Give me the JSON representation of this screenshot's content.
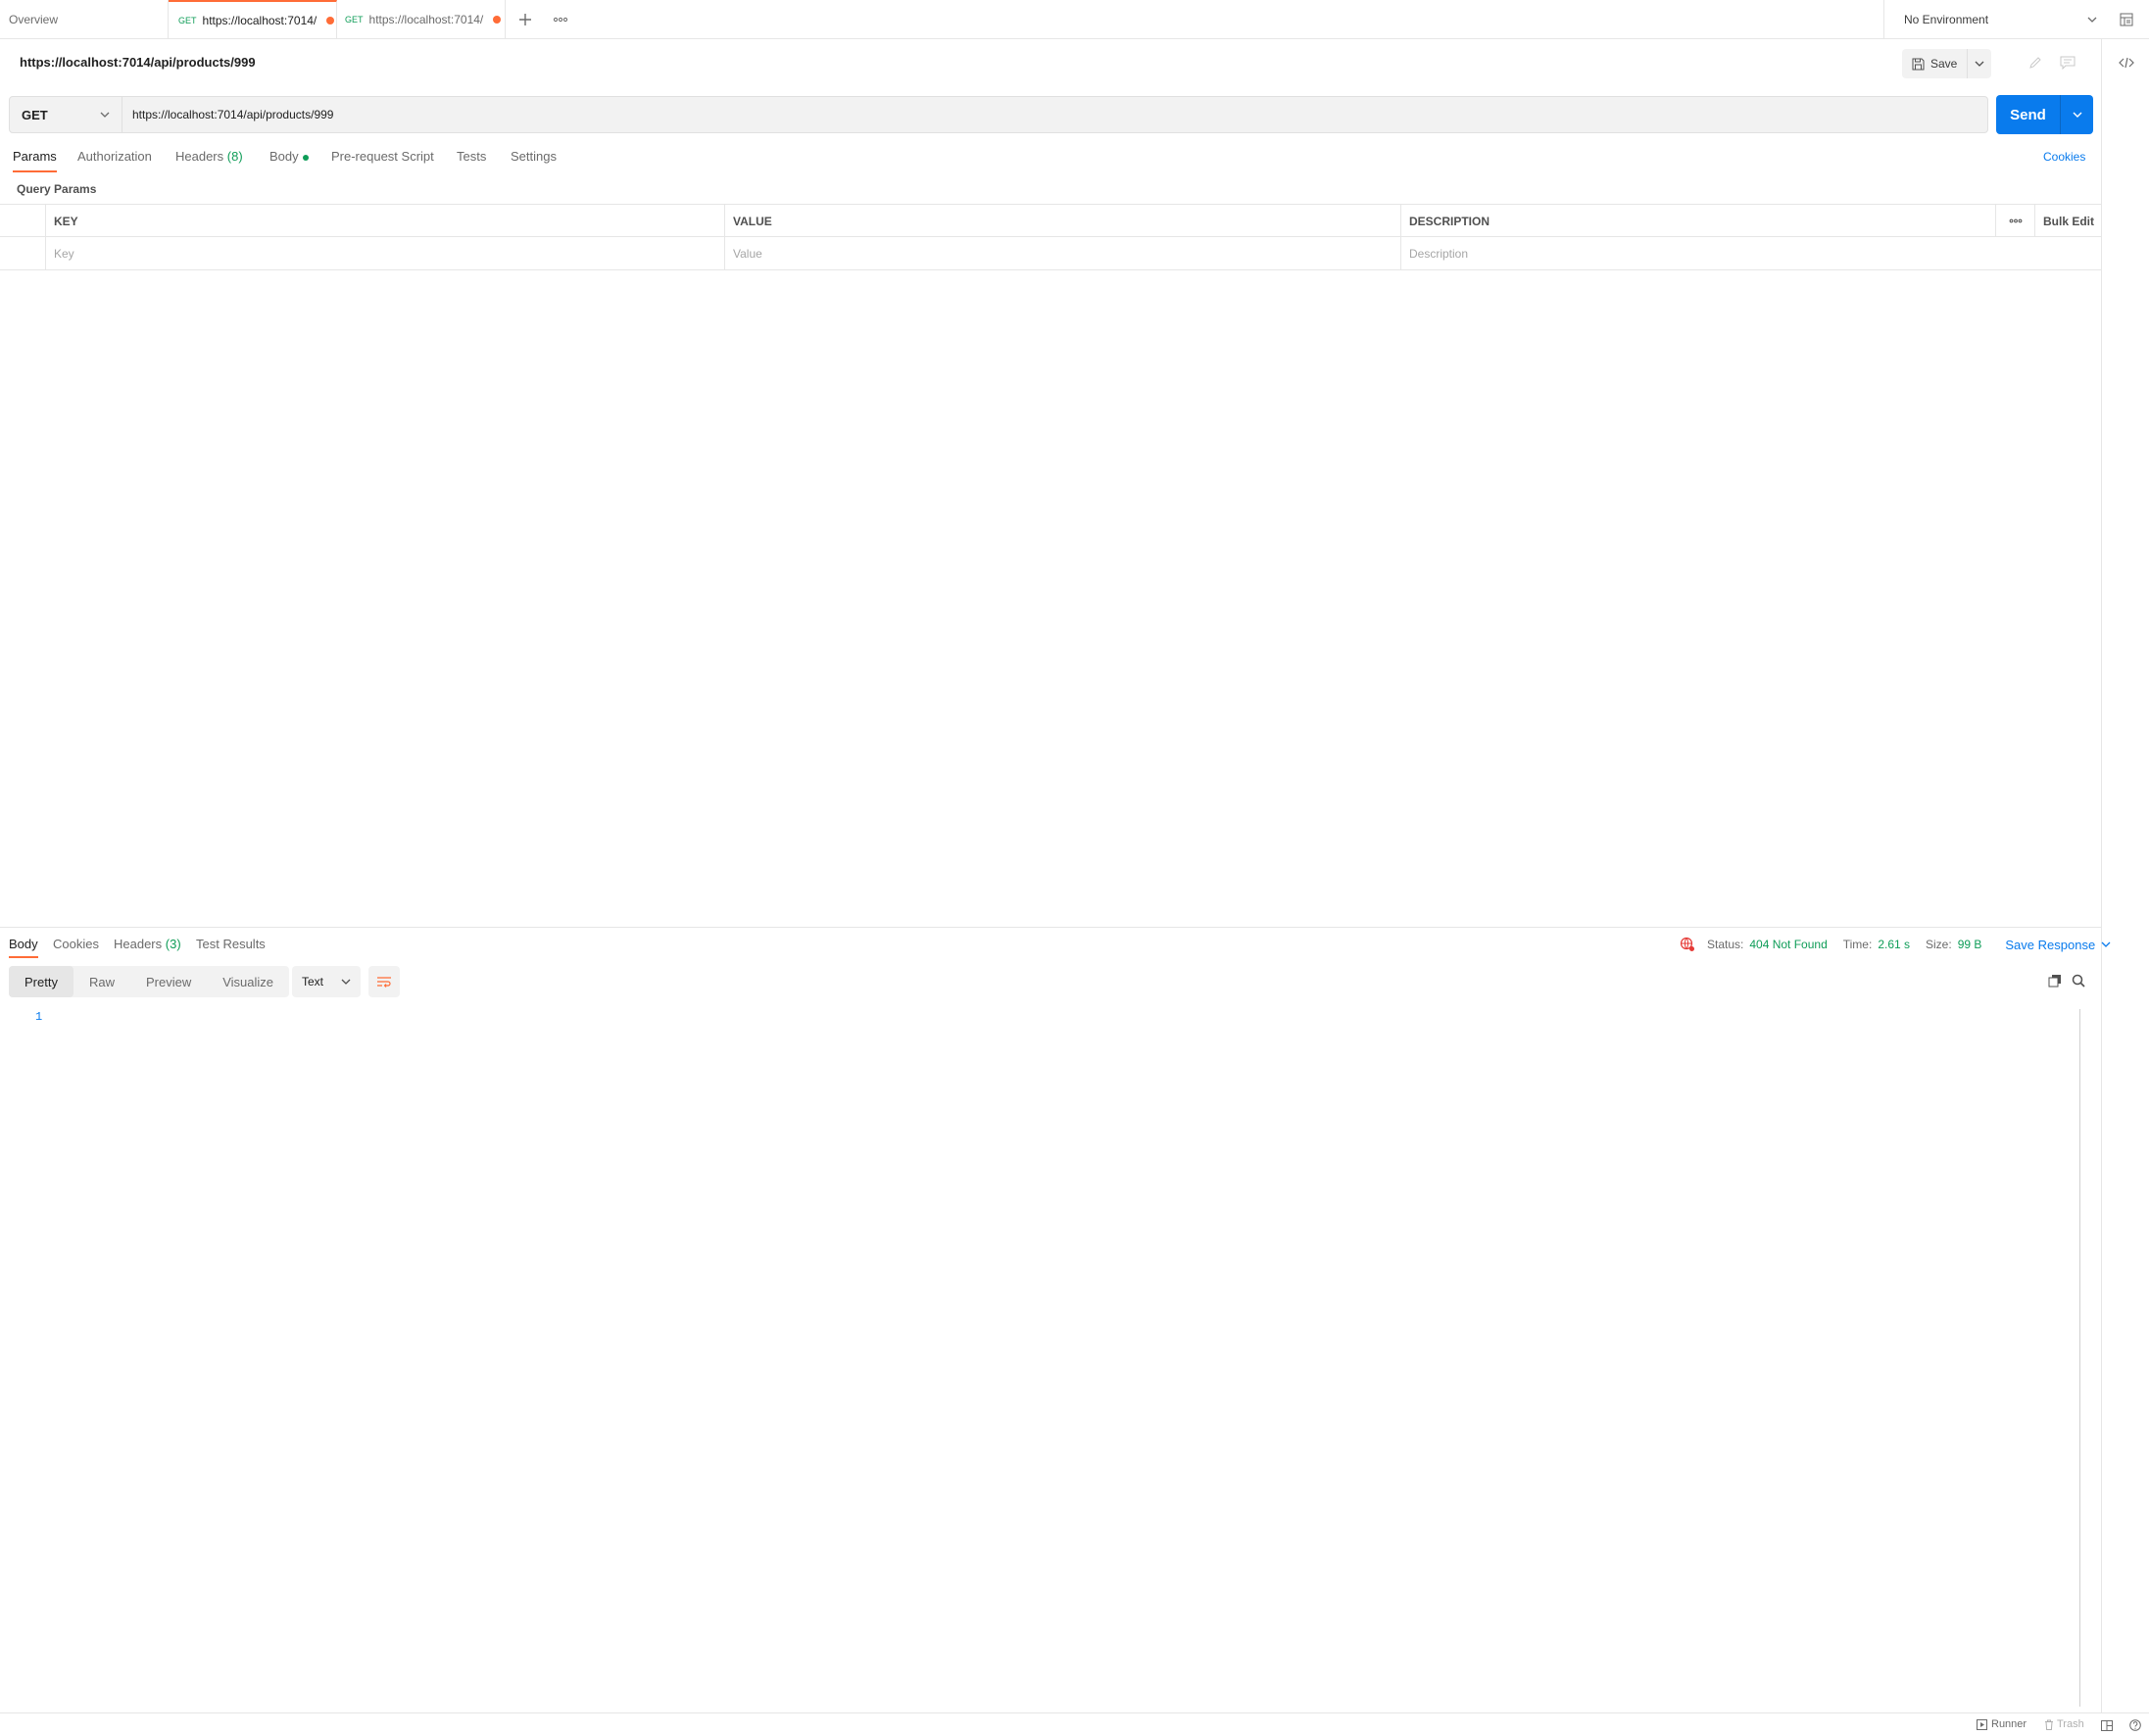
{
  "tabs": {
    "overview": "Overview",
    "items": [
      {
        "method": "GET",
        "label": "https://localhost:7014/"
      },
      {
        "method": "GET",
        "label": "https://localhost:7014/"
      }
    ]
  },
  "environment": {
    "selected": "No Environment"
  },
  "request": {
    "title": "https://localhost:7014/api/products/999",
    "method": "GET",
    "url": "https://localhost:7014/api/products/999",
    "save_label": "Save",
    "send_label": "Send"
  },
  "request_tabs": {
    "params": "Params",
    "authorization": "Authorization",
    "headers": "Headers",
    "headers_count": "(8)",
    "body": "Body",
    "prerequest": "Pre-request Script",
    "tests": "Tests",
    "settings": "Settings",
    "cookies": "Cookies"
  },
  "params": {
    "section_label": "Query Params",
    "columns": {
      "key": "KEY",
      "value": "VALUE",
      "description": "DESCRIPTION"
    },
    "bulk_edit": "Bulk Edit",
    "placeholders": {
      "key": "Key",
      "value": "Value",
      "description": "Description"
    }
  },
  "response": {
    "tabs": {
      "body": "Body",
      "cookies": "Cookies",
      "headers": "Headers",
      "headers_count": "(3)",
      "test_results": "Test Results"
    },
    "status_label": "Status:",
    "status_value": "404 Not Found",
    "time_label": "Time:",
    "time_value": "2.61 s",
    "size_label": "Size:",
    "size_value": "99 B",
    "save_response": "Save Response",
    "views": [
      "Pretty",
      "Raw",
      "Preview",
      "Visualize"
    ],
    "format": "Text",
    "line_number": "1"
  },
  "footer": {
    "runner": "Runner",
    "trash": "Trash"
  },
  "colors": {
    "accent": "#ff6c37",
    "primary": "#097bed",
    "success": "#0f9d58"
  }
}
